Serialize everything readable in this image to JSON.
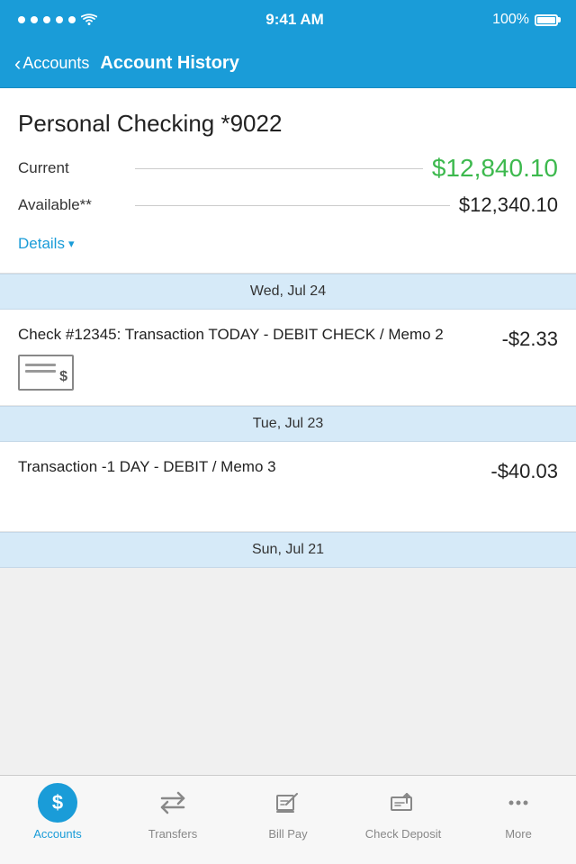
{
  "statusBar": {
    "time": "9:41 AM",
    "battery": "100%"
  },
  "navBar": {
    "backLabel": "Accounts",
    "title": "Account History"
  },
  "account": {
    "name": "Personal Checking *9022",
    "currentLabel": "Current",
    "currentBalance": "$12,840.10",
    "availableLabel": "Available**",
    "availableBalance": "$12,340.10",
    "detailsLabel": "Details"
  },
  "transactions": [
    {
      "dateHeader": "Wed, Jul 24",
      "items": [
        {
          "description": "Check #12345: Transaction TODAY - DEBIT CHECK / Memo 2",
          "amount": "-$2.33",
          "hasCheckIcon": true
        }
      ]
    },
    {
      "dateHeader": "Tue, Jul 23",
      "items": [
        {
          "description": "Transaction -1 DAY - DEBIT / Memo 3",
          "amount": "-$40.03",
          "hasCheckIcon": false
        }
      ]
    },
    {
      "dateHeader": "Sun, Jul 21",
      "items": []
    }
  ],
  "tabBar": {
    "tabs": [
      {
        "id": "accounts",
        "label": "Accounts",
        "active": true
      },
      {
        "id": "transfers",
        "label": "Transfers",
        "active": false
      },
      {
        "id": "billpay",
        "label": "Bill Pay",
        "active": false
      },
      {
        "id": "checkdeposit",
        "label": "Check Deposit",
        "active": false
      },
      {
        "id": "more",
        "label": "More",
        "active": false
      }
    ]
  }
}
